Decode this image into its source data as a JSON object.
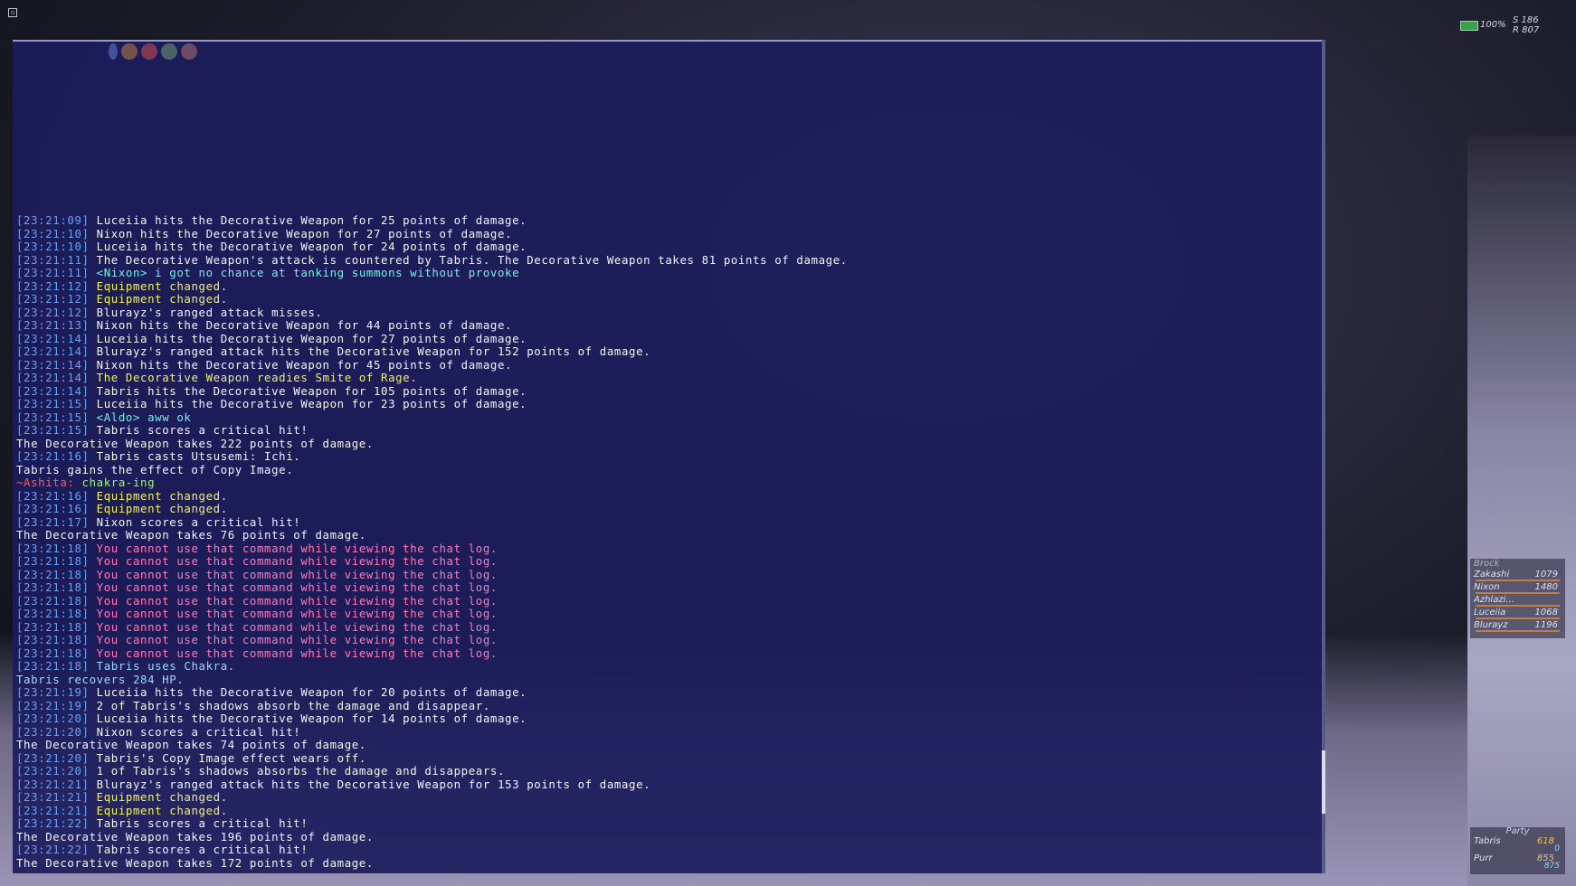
{
  "status": {
    "battery_pct": "100%",
    "line1": "S 186",
    "line2": "R 807"
  },
  "chat": {
    "lines": [
      {
        "ts": "[23:21:09]",
        "text": "Luceiia hits the Decorative Weapon for 25 points of damage.",
        "color": "white"
      },
      {
        "ts": "[23:21:10]",
        "text": "Nixon hits the Decorative Weapon for 27 points of damage.",
        "color": "white"
      },
      {
        "ts": "[23:21:10]",
        "text": "Luceiia hits the Decorative Weapon for 24 points of damage.",
        "color": "white"
      },
      {
        "ts": "[23:21:11]",
        "text": "The Decorative Weapon's attack is countered by Tabris. The Decorative Weapon takes 81 points of damage.",
        "color": "white"
      },
      {
        "ts": "[23:21:11]",
        "text": "<Nixon> i got no chance at tanking summons without provoke",
        "color": "cyan"
      },
      {
        "ts": "[23:21:12]",
        "text": "Equipment changed.",
        "color": "yellow"
      },
      {
        "ts": "[23:21:12]",
        "text": "Equipment changed.",
        "color": "yellow"
      },
      {
        "ts": "[23:21:12]",
        "text": "Blurayz's ranged attack misses.",
        "color": "white"
      },
      {
        "ts": "[23:21:13]",
        "text": "Nixon hits the Decorative Weapon for 44 points of damage.",
        "color": "white"
      },
      {
        "ts": "[23:21:14]",
        "text": "Luceiia hits the Decorative Weapon for 27 points of damage.",
        "color": "white"
      },
      {
        "ts": "[23:21:14]",
        "text": "Blurayz's ranged attack hits the Decorative Weapon for 152 points of damage.",
        "color": "white"
      },
      {
        "ts": "[23:21:14]",
        "text": "Nixon hits the Decorative Weapon for 45 points of damage.",
        "color": "white"
      },
      {
        "ts": "[23:21:14]",
        "text": "The Decorative Weapon readies Smite of Rage.",
        "color": "yellow"
      },
      {
        "ts": "[23:21:14]",
        "text": "Tabris hits the Decorative Weapon for 105 points of damage.",
        "color": "white"
      },
      {
        "ts": "[23:21:15]",
        "text": "Luceiia hits the Decorative Weapon for 23 points of damage.",
        "color": "white"
      },
      {
        "ts": "[23:21:15]",
        "text": "<Aldo> aww ok",
        "color": "cyan"
      },
      {
        "ts": "[23:21:15]",
        "text": "Tabris scores a critical hit!",
        "color": "white"
      },
      {
        "ts": "",
        "text": "The Decorative Weapon takes 222 points of damage.",
        "color": "white"
      },
      {
        "ts": "[23:21:16]",
        "text": "Tabris casts Utsusemi: Ichi.",
        "color": "white"
      },
      {
        "ts": "",
        "text": "Tabris gains the effect of Copy Image.",
        "color": "white"
      },
      {
        "ts": "",
        "prefix": "~Ashita: ",
        "text": "chakra-ing",
        "color": "green"
      },
      {
        "ts": "[23:21:16]",
        "text": "Equipment changed.",
        "color": "yellow"
      },
      {
        "ts": "[23:21:16]",
        "text": "Equipment changed.",
        "color": "yellow"
      },
      {
        "ts": "[23:21:17]",
        "text": "Nixon scores a critical hit!",
        "color": "white"
      },
      {
        "ts": "",
        "text": "The Decorative Weapon takes 76 points of damage.",
        "color": "white"
      },
      {
        "ts": "[23:21:18]",
        "text": "You cannot use that command while viewing the chat log.",
        "color": "pink"
      },
      {
        "ts": "[23:21:18]",
        "text": "You cannot use that command while viewing the chat log.",
        "color": "pink"
      },
      {
        "ts": "[23:21:18]",
        "text": "You cannot use that command while viewing the chat log.",
        "color": "pink"
      },
      {
        "ts": "[23:21:18]",
        "text": "You cannot use that command while viewing the chat log.",
        "color": "pink"
      },
      {
        "ts": "[23:21:18]",
        "text": "You cannot use that command while viewing the chat log.",
        "color": "pink"
      },
      {
        "ts": "[23:21:18]",
        "text": "You cannot use that command while viewing the chat log.",
        "color": "pink"
      },
      {
        "ts": "[23:21:18]",
        "text": "You cannot use that command while viewing the chat log.",
        "color": "pink"
      },
      {
        "ts": "[23:21:18]",
        "text": "You cannot use that command while viewing the chat log.",
        "color": "pink"
      },
      {
        "ts": "[23:21:18]",
        "text": "You cannot use that command while viewing the chat log.",
        "color": "pink"
      },
      {
        "ts": "[23:21:18]",
        "text": "Tabris uses Chakra.",
        "color": "lightblue"
      },
      {
        "ts": "",
        "text": "Tabris recovers 284 HP.",
        "color": "lightblue"
      },
      {
        "ts": "[23:21:19]",
        "text": "Luceiia hits the Decorative Weapon for 20 points of damage.",
        "color": "white"
      },
      {
        "ts": "[23:21:19]",
        "text": "2 of Tabris's shadows absorb the damage and disappear.",
        "color": "white"
      },
      {
        "ts": "[23:21:20]",
        "text": "Luceiia hits the Decorative Weapon for 14 points of damage.",
        "color": "white"
      },
      {
        "ts": "[23:21:20]",
        "text": "Nixon scores a critical hit!",
        "color": "white"
      },
      {
        "ts": "",
        "text": "The Decorative Weapon takes 74 points of damage.",
        "color": "white"
      },
      {
        "ts": "[23:21:20]",
        "text": "Tabris's Copy Image effect wears off.",
        "color": "white"
      },
      {
        "ts": "[23:21:20]",
        "text": "1 of Tabris's shadows absorbs the damage and disappears.",
        "color": "white"
      },
      {
        "ts": "[23:21:21]",
        "text": "Blurayz's ranged attack hits the Decorative Weapon for 153 points of damage.",
        "color": "white"
      },
      {
        "ts": "[23:21:21]",
        "text": "Equipment changed.",
        "color": "yellow"
      },
      {
        "ts": "[23:21:21]",
        "text": "Equipment changed.",
        "color": "yellow"
      },
      {
        "ts": "[23:21:22]",
        "text": "Tabris scores a critical hit!",
        "color": "white"
      },
      {
        "ts": "",
        "text": "The Decorative Weapon takes 196 points of damage.",
        "color": "white"
      },
      {
        "ts": "[23:21:22]",
        "text": "Tabris scores a critical hit!",
        "color": "white"
      },
      {
        "ts": "",
        "text": "The Decorative Weapon takes 172 points of damage.",
        "color": "white"
      }
    ]
  },
  "alliance": {
    "header": "Brock",
    "members": [
      {
        "name": "Zakashi",
        "hp": "1079"
      },
      {
        "name": "Nixon",
        "hp": "1480"
      },
      {
        "name": "Azhlazi...",
        "hp": ""
      },
      {
        "name": "Luceiia",
        "hp": "1068"
      },
      {
        "name": "Blurayz",
        "hp": "1196"
      }
    ]
  },
  "party": {
    "title": "Party",
    "members": [
      {
        "name": "Tabris",
        "hp": "618",
        "mp": "0"
      },
      {
        "name": "Purr",
        "hp": "855",
        "mp": "875"
      }
    ]
  },
  "colors": {
    "white": "#f4f4f4",
    "yellow": "#f0f070",
    "cyan": "#72f0e2",
    "pink": "#ff7ab8",
    "lightblue": "#9ad8ff",
    "green": "#9cf27a",
    "timestamp": "#6a9ff2",
    "ashita_prefix": "#ff5a5a"
  }
}
